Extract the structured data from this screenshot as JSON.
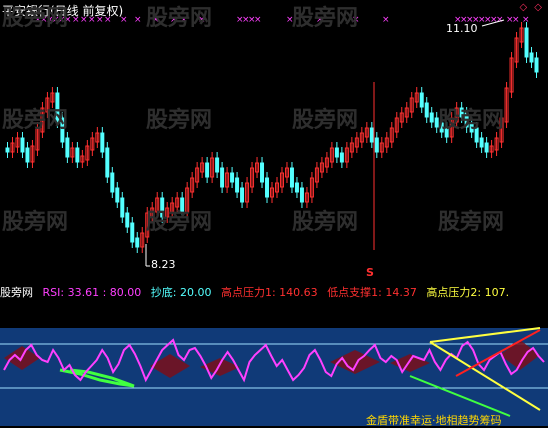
{
  "title": "平安银行(日线 前复权)",
  "annotations": {
    "high": "11.10",
    "low": "8.23",
    "signal": "S"
  },
  "top_right_markers": "◇ ◇",
  "watermark": "股旁网",
  "indicator": {
    "name": "股旁网",
    "rsi_label": "RSI: 33.61",
    "level_80": ": 80.00",
    "bottom_label": "抄底: 20.00",
    "high_pressure1": "高点压力1: 140.63",
    "low_support1": "低点支撑1: 14.37",
    "high_pressure2": "高点压力2: 107."
  },
  "footer_text": "金盾带准幸运·地相趋势筹码",
  "colors": {
    "up": "#ff3030",
    "down": "#54ffff",
    "rsi": "#ff40ff",
    "band": "#103a78",
    "hline": "#a0e0ff",
    "support": "#ffff40",
    "green": "#40ff40",
    "trend_red": "#ff2020"
  }
}
